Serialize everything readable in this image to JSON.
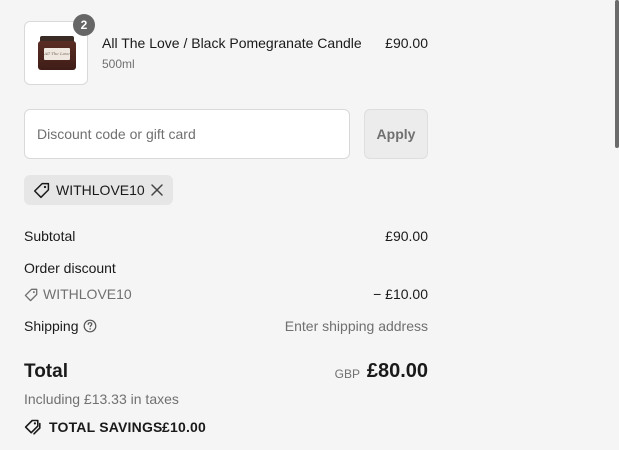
{
  "product": {
    "quantity": "2",
    "title": "All The Love / Black Pomegranate Candle",
    "variant": "500ml",
    "price": "£90.00",
    "image_label": "All The Love",
    "image_icon": "candle-jar-image"
  },
  "discount": {
    "placeholder": "Discount code or gift card",
    "apply_label": "Apply",
    "applied_code": "WITHLOVE10"
  },
  "summary": {
    "subtotal_label": "Subtotal",
    "subtotal_value": "£90.00",
    "order_discount_label": "Order discount",
    "discount_code": "WITHLOVE10",
    "discount_value": "− £10.00",
    "shipping_label": "Shipping",
    "shipping_value": "Enter shipping address",
    "total_label": "Total",
    "currency": "GBP",
    "total_value": "£80.00",
    "taxes_note": "Including £13.33 in taxes",
    "savings_label": "TOTAL SAVINGS",
    "savings_value": "£10.00"
  },
  "colors": {
    "background": "#f5f5f5",
    "text": "#1a1a1a",
    "muted": "#707070",
    "badge": "#666666"
  }
}
